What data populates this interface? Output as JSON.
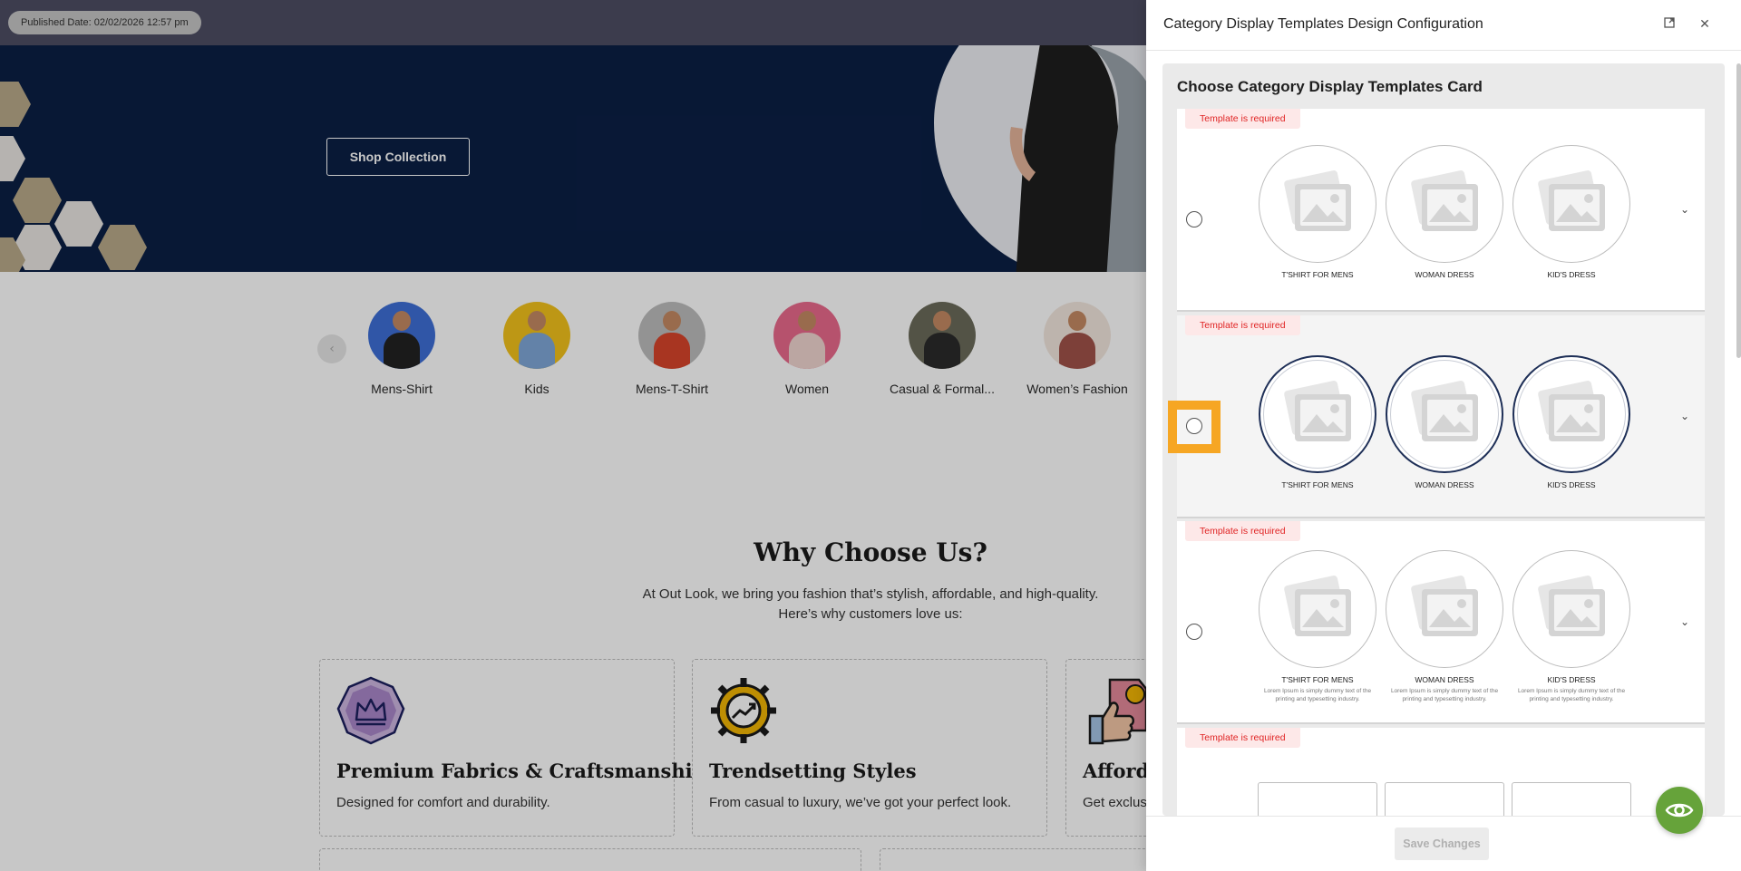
{
  "site": {
    "published_date": "Published Date: 02/02/2026 12:57 pm",
    "hero": {
      "shop_button": "Shop Collection"
    },
    "categories": [
      {
        "label": "Mens-Shirt",
        "color": "#3e6fd6",
        "cloth": "#222222"
      },
      {
        "label": "Kids",
        "color": "#f2c21b",
        "cloth": "#7fa7d8"
      },
      {
        "label": "Mens-T-Shirt",
        "color": "#bdbdbd",
        "cloth": "#d8452b"
      },
      {
        "label": "Women",
        "color": "#e96a8c",
        "cloth": "#f0d5d0"
      },
      {
        "label": "Casual & Formal...",
        "color": "#6b6b5a",
        "cloth": "#2b2b2b"
      },
      {
        "label": "Women’s Fashion",
        "color": "#f3e7de",
        "cloth": "#a0524a"
      }
    ],
    "why": {
      "title": "Why Choose Us?",
      "subtitle_line1": "At Out Look, we bring you fashion that’s stylish, affordable, and high-quality.",
      "subtitle_line2": "Here’s why customers love us:"
    },
    "features": [
      {
        "title": "Premium Fabrics & Craftsmanship",
        "desc": "Designed for comfort and durability.",
        "icon": "crown-icon"
      },
      {
        "title": "Trendsetting Styles",
        "desc": "From casual to luxury, we’ve got your perfect look.",
        "icon": "gear-trend-icon"
      },
      {
        "title": "Afforda",
        "desc": "Get exclus",
        "icon": "price-tag-thumb-icon"
      }
    ]
  },
  "drawer": {
    "title": "Category Display Templates Design Configuration",
    "section_title": "Choose Category Display Templates Card",
    "badge": "Template is required",
    "templates": [
      {
        "style": "circle",
        "items": [
          "T'SHIRT FOR MENS",
          "WOMAN DRESS",
          "KID'S DRESS"
        ]
      },
      {
        "style": "circle-bordered",
        "items": [
          "T'SHIRT FOR MENS",
          "WOMAN DRESS",
          "KID'S DRESS"
        ]
      },
      {
        "style": "circle-desc",
        "items": [
          "T'SHIRT FOR MENS",
          "WOMAN DRESS",
          "KID'S DRESS"
        ],
        "desc": "Lorem Ipsum is simply dummy text of the printing and typesetting industry."
      },
      {
        "style": "square",
        "items": [
          "",
          "",
          ""
        ]
      }
    ],
    "save_button": "Save Changes"
  },
  "colors": {
    "hero_bg": "#0b1f45",
    "badge_text": "#e02424",
    "highlight": "#f6a623",
    "fab": "#66a33a"
  }
}
